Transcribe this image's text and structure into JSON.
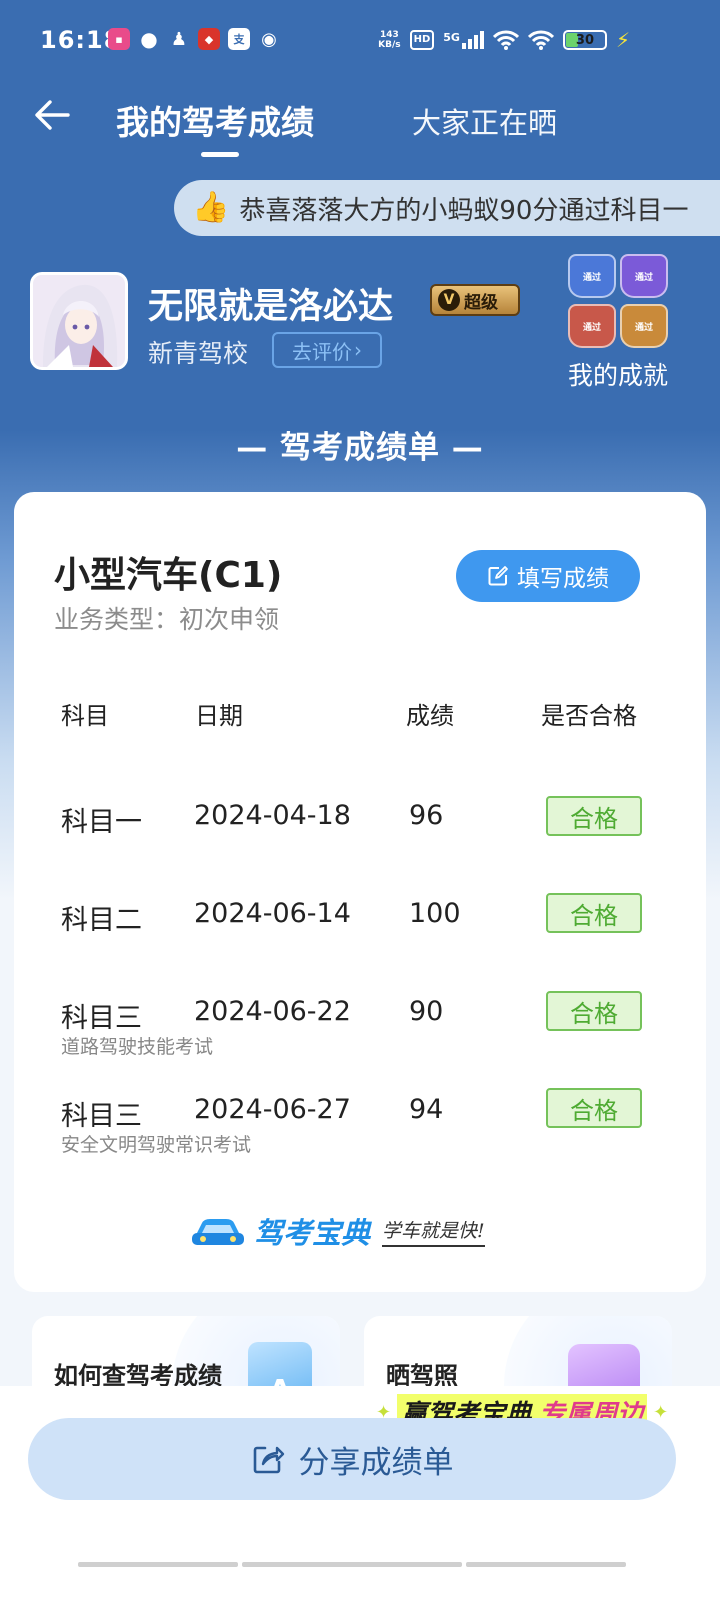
{
  "status_bar": {
    "time": "16:18",
    "net_speed_value": "143",
    "net_speed_unit": "KB/s",
    "hd": "HD",
    "network": "5G",
    "battery": "30"
  },
  "header": {
    "tab_active": "我的驾考成绩",
    "tab_other": "大家正在晒"
  },
  "ticker": {
    "text": "恭喜落落大方的小蚂蚁90分通过科目一"
  },
  "profile": {
    "username": "无限就是洛必达",
    "vip_label": "超级",
    "school": "新青驾校",
    "rate_button": "去评价",
    "achievement_label": "我的成就",
    "medals": [
      {
        "label": "通过",
        "color": "#4b78d8"
      },
      {
        "label": "通过",
        "color": "#7b5ad8"
      },
      {
        "label": "通过",
        "color": "#c8584a"
      },
      {
        "label": "通过",
        "color": "#c98a3a"
      }
    ]
  },
  "section_title": "— 驾考成绩单 —",
  "card": {
    "car_type": "小型汽车(C1)",
    "business_type": "业务类型：初次申领",
    "fill_button": "填写成绩",
    "columns": [
      "科目",
      "日期",
      "成绩",
      "是否合格"
    ],
    "rows": [
      {
        "subject": "科目一",
        "sub": "",
        "date": "2024-04-18",
        "score": "96",
        "status": "合格"
      },
      {
        "subject": "科目二",
        "sub": "",
        "date": "2024-06-14",
        "score": "100",
        "status": "合格"
      },
      {
        "subject": "科目三",
        "sub": "道路驾驶技能考试",
        "date": "2024-06-22",
        "score": "90",
        "status": "合格"
      },
      {
        "subject": "科目三",
        "sub": "安全文明驾驶常识考试",
        "date": "2024-06-27",
        "score": "94",
        "status": "合格"
      }
    ],
    "brand_name": "驾考宝典",
    "brand_slogan": "学车就是快!"
  },
  "promos": [
    {
      "title": "如何查驾考成绩",
      "icon_text": "A"
    },
    {
      "title": "晒驾照"
    }
  ],
  "promo_banner": {
    "text_dark": "赢驾考宝典",
    "text_pink": "专属周边"
  },
  "share_button": "分享成绩单",
  "colors": {
    "primary_blue": "#3a6db1",
    "button_blue": "#3f98ef",
    "pass_green": "#4fab33"
  }
}
